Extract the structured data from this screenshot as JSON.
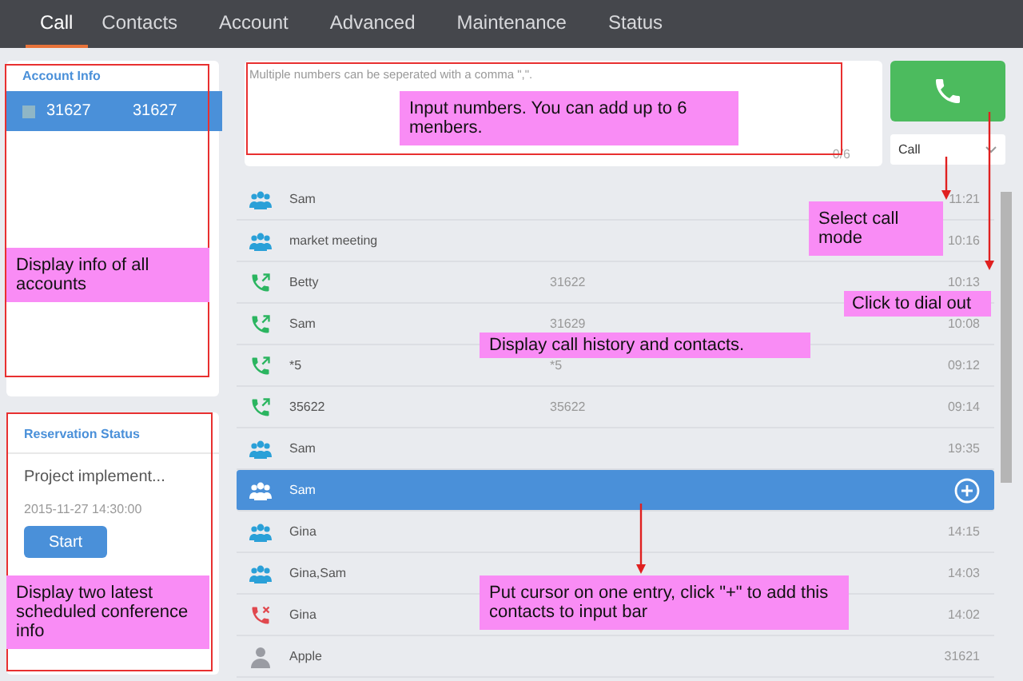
{
  "nav": {
    "tabs": [
      {
        "label": "Call",
        "selected": true
      },
      {
        "label": "Contacts",
        "selected": false
      },
      {
        "label": "Account",
        "selected": false
      },
      {
        "label": "Advanced",
        "selected": false
      },
      {
        "label": "Maintenance",
        "selected": false
      },
      {
        "label": "Status",
        "selected": false
      }
    ]
  },
  "account_info": {
    "title": "Account Info",
    "items": [
      {
        "name": "31627",
        "number": "31627",
        "selected": true
      }
    ]
  },
  "reservation_status": {
    "title": "Reservation Status",
    "items": [
      {
        "subject": "Project implement...",
        "time": "2015-11-27 14:30:00",
        "button": "Start"
      }
    ]
  },
  "number_input": {
    "placeholder": "Multiple numbers can be seperated with a comma \",\".",
    "counter": "0/6"
  },
  "call_mode": {
    "value": "Call"
  },
  "history": [
    {
      "kind": "group",
      "name": "Sam",
      "time": "11:21",
      "selected": false
    },
    {
      "kind": "group",
      "name": "market meeting",
      "time": "10:16",
      "selected": false
    },
    {
      "kind": "outgoing",
      "name": "Betty",
      "number": "31622",
      "time": "10:13",
      "selected": false
    },
    {
      "kind": "outgoing",
      "name": "Sam",
      "number": "31629",
      "time": "10:08",
      "selected": false
    },
    {
      "kind": "outgoing",
      "name": "*5",
      "number": "*5",
      "time": "09:12",
      "selected": false
    },
    {
      "kind": "outgoing",
      "name": "35622",
      "number": "35622",
      "time": "09:14",
      "selected": false
    },
    {
      "kind": "group",
      "name": "Sam",
      "time": "19:35",
      "selected": false
    },
    {
      "kind": "group",
      "name": "Sam",
      "selected": true
    },
    {
      "kind": "group",
      "name": "Gina",
      "time": "14:15",
      "selected": false
    },
    {
      "kind": "group",
      "name": "Gina,Sam",
      "time": "14:03",
      "selected": false
    },
    {
      "kind": "missed",
      "name": "Gina",
      "time": "14:02",
      "selected": false
    },
    {
      "kind": "contact",
      "name": "Apple",
      "time": "31621",
      "selected": false
    }
  ],
  "annotations": [
    "Input numbers. You can add up to 6 menbers.",
    "Select call mode",
    "Click to dial out",
    "Display call history and contacts.",
    "Display info of all accounts",
    "Display two latest scheduled conference info",
    "Put cursor on one entry, click \"+\" to add this contacts to input bar"
  ]
}
